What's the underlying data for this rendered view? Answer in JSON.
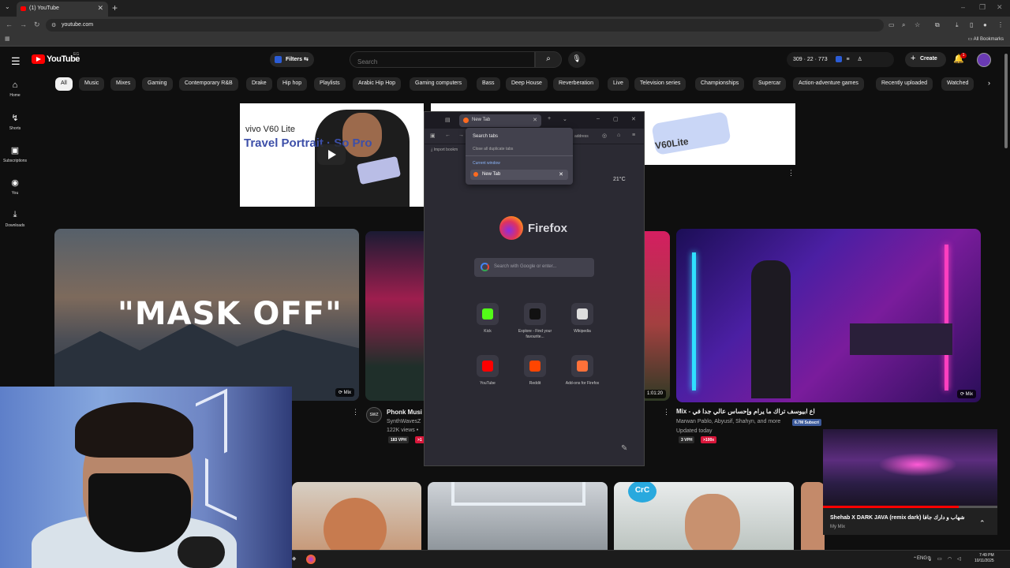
{
  "browser": {
    "tab_title": "(1) YouTube",
    "tab_close": "✕",
    "new_tab": "+",
    "url": "youtube.com",
    "all_bookmarks": "All Bookmarks"
  },
  "header": {
    "logo_text": "YouTube",
    "country": "EG",
    "filters_label": "Filters",
    "search_placeholder": "Search",
    "stats_text": "309 · 22 · 773",
    "create_label": "Create",
    "notif_count": "1"
  },
  "sidebar": {
    "items": [
      {
        "label": "Home",
        "icon": "⌂"
      },
      {
        "label": "Shorts",
        "icon": "↯"
      },
      {
        "label": "Subscriptions",
        "icon": "▣"
      },
      {
        "label": "You",
        "icon": "◉"
      },
      {
        "label": "Downloads",
        "icon": "⤓"
      }
    ]
  },
  "chips": [
    "All",
    "Music",
    "Mixes",
    "Gaming",
    "Contemporary R&B",
    "Drake",
    "Hip hop",
    "Playlists",
    "Arabic Hip Hop",
    "Gaming computers",
    "Bass",
    "Deep House",
    "Reverberation",
    "Live",
    "Television series",
    "Championships",
    "Supercar",
    "Action-adventure games",
    "Recently uploaded",
    "Watched"
  ],
  "ads": {
    "left_brand": "vivo V60 Lite",
    "left_headline": "Travel Portrait · So Pro",
    "right_brand": "V60Lite"
  },
  "videos": {
    "mask_text": "\"MASK OFF\"",
    "mask_badge": "Mix",
    "phonk_avatar": "SWZ",
    "phonk_title": "Phonk Musi",
    "phonk_channel": "SynthWavesZ",
    "phonk_views": "122K views •",
    "phonk_vph": "183 VPH",
    "phonk_tag": ">1",
    "red_duration": "1:01:20",
    "mix_badge": "Mix",
    "mix_title": "Mix - ثالث وابداع ابيوسف تراك ما يرام وإحساس عالي جدا في Rap Game",
    "mix_channels": "Marwan Pablo, Abyusif, Shahyn, and more",
    "mix_subs": "6.7M Subscri",
    "mix_updated": "Updated today",
    "mix_vph": "3 VPH",
    "mix_tag": ">100x",
    "crc_label": "CrC"
  },
  "firefox": {
    "tab_title": "New Tab",
    "import": "Import bookm",
    "address_hint": "address",
    "temperature": "21°C",
    "logo_word": "Firefox",
    "search_placeholder": "Search with Google or enter...",
    "tiles": [
      {
        "label": "Kick",
        "color": "#53fc18"
      },
      {
        "label": "Explore - Find your favourite...",
        "color": "#111111"
      },
      {
        "label": "Wikipedia",
        "color": "#dddddd"
      },
      {
        "label": "YouTube",
        "color": "#ff0000"
      },
      {
        "label": "Reddit",
        "color": "#ff4500"
      },
      {
        "label": "Add-ons for Firefox",
        "color": "#ff7139"
      }
    ],
    "popup": {
      "title": "Search tabs",
      "close_dupes": "Close all duplicate tabs",
      "current_window": "Current window",
      "item": "New Tab"
    }
  },
  "mini_player": {
    "title": "Shehab X DARK JAVA (remix dark) شهاب و دارك جافا",
    "subtitle": "My Mix",
    "progress": 0.78
  },
  "taskbar": {
    "lang": "ENG",
    "time": "7:49 PM",
    "date": "10/11/2025"
  }
}
